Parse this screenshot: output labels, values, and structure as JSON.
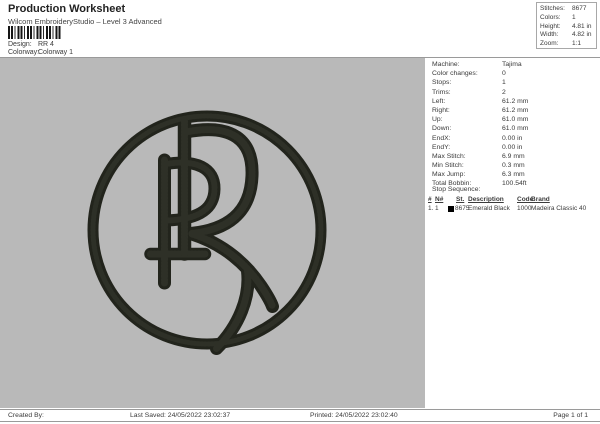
{
  "header": {
    "title": "Production Worksheet",
    "subtitle": "Wilcom EmbroideryStudio – Level 3 Advanced",
    "design_label": "Design:",
    "design_value": "RR 4",
    "colorway_label": "Colorway:",
    "colorway_value": "Colorway 1",
    "stats": [
      {
        "label": "Stitches:",
        "value": "8677"
      },
      {
        "label": "Colors:",
        "value": "1"
      },
      {
        "label": "Height:",
        "value": "4.81 in"
      },
      {
        "label": "Width:",
        "value": "4.82 in"
      },
      {
        "label": "Zoom:",
        "value": "1:1"
      }
    ]
  },
  "machine_info": [
    {
      "label": "Machine:",
      "value": "Tajima"
    },
    {
      "label": "Color changes:",
      "value": "0"
    },
    {
      "label": "Stops:",
      "value": "1"
    },
    {
      "label": "Trims:",
      "value": "2"
    },
    {
      "label": "Left:",
      "value": "61.2 mm"
    },
    {
      "label": "Right:",
      "value": "61.2 mm"
    },
    {
      "label": "Up:",
      "value": "61.0 mm"
    },
    {
      "label": "Down:",
      "value": "61.0 mm"
    },
    {
      "label": "EndX:",
      "value": "0.00 in"
    },
    {
      "label": "EndY:",
      "value": "0.00 in"
    },
    {
      "label": "Max Stitch:",
      "value": "6.9 mm"
    },
    {
      "label": "Min Stitch:",
      "value": "0.3 mm"
    },
    {
      "label": "Max Jump:",
      "value": "6.3 mm"
    },
    {
      "label": "Total Bobbin:",
      "value": "100.54ft"
    }
  ],
  "stop_sequence": {
    "title": "Stop Sequence:",
    "columns": {
      "num": "#",
      "n": "N#",
      "st": "St.",
      "description": "Description",
      "code": "Code",
      "brand": "Brand"
    },
    "rows": [
      {
        "num": "1.",
        "n": "1",
        "swatch_color": "#000000",
        "st": "8675",
        "description": "Emerald Black",
        "code": "1000",
        "brand": "Madeira Classic 40"
      }
    ]
  },
  "design_preview": {
    "name": "RR monogram embroidery design",
    "thread_color": "#22241c",
    "thread_highlight": "#31332a",
    "canvas_color": "#b9b9b9"
  },
  "footer": {
    "created_by": "Created By:",
    "last_saved": "Last Saved: 24/05/2022 23:02:37",
    "printed": "Printed: 24/05/2022 23:02:40",
    "page": "Page 1 of 1"
  }
}
